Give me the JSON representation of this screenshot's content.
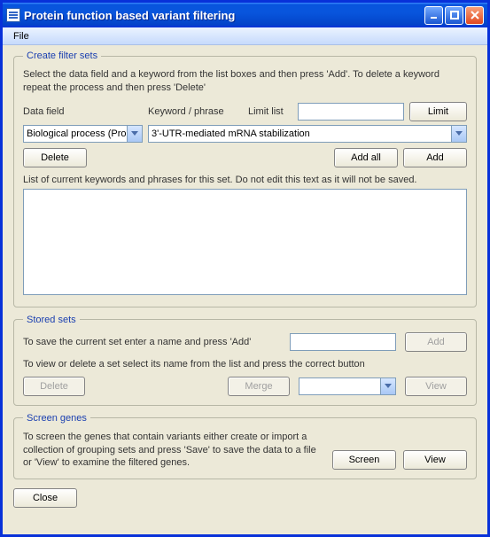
{
  "title": "Protein function based variant filtering",
  "menubar": {
    "file": "File"
  },
  "create": {
    "legend": "Create filter sets",
    "instructions": "Select the data field and a keyword from the list boxes and then press 'Add'. To delete a keyword repeat the process and then press 'Delete'",
    "data_field_label": "Data field",
    "keyword_label": "Keyword / phrase",
    "limit_label": "Limit list",
    "limit_value": "",
    "limit_button": "Limit",
    "data_field_value": "Biological process (Prote",
    "keyword_value": "3'-UTR-mediated mRNA stabilization",
    "delete_button": "Delete",
    "add_all_button": "Add all",
    "add_button": "Add",
    "list_label": "List of current keywords and phrases for this set. Do not edit this text as it will not be saved.",
    "list_value": ""
  },
  "stored": {
    "legend": "Stored sets",
    "save_instructions": "To save the current set enter a name and press 'Add'",
    "name_value": "",
    "add_button": "Add",
    "view_instructions": "To view or delete a set select its name from the list and press the correct button",
    "delete_button": "Delete",
    "merge_button": "Merge",
    "select_value": "",
    "view_button": "View"
  },
  "screen": {
    "legend": "Screen genes",
    "instructions": "To screen the genes that contain variants either create or import a collection of grouping sets and press 'Save' to save the data to a file or 'View' to examine the filtered genes.",
    "screen_button": "Screen",
    "view_button": "View"
  },
  "footer": {
    "close_button": "Close"
  }
}
